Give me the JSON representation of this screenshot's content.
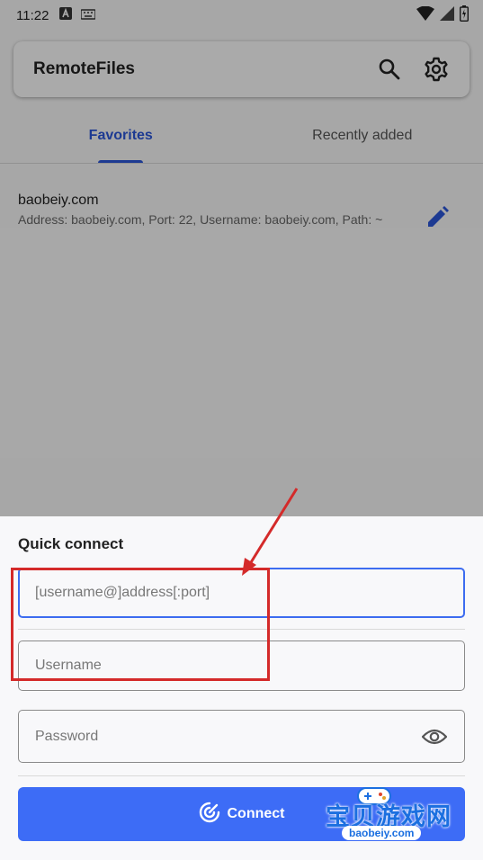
{
  "status_bar": {
    "time": "11:22"
  },
  "header": {
    "title": "RemoteFiles",
    "search_icon": "search-icon",
    "settings_icon": "gear-icon"
  },
  "tabs": [
    {
      "label": "Favorites",
      "active": true
    },
    {
      "label": "Recently added",
      "active": false
    }
  ],
  "favorites": [
    {
      "name": "baobeiy.com",
      "details": "Address: baobeiy.com, Port: 22, Username: baobeiy.com, Path: ~"
    }
  ],
  "quick_connect": {
    "title": "Quick connect",
    "address_placeholder": "[username@]address[:port]",
    "username_placeholder": "Username",
    "password_placeholder": "Password",
    "connect_label": "Connect"
  },
  "watermark": {
    "cn": "宝贝游戏网",
    "en": "baobeiy.com"
  },
  "colors": {
    "accent": "#3d6cf6",
    "annotation": "#d42a2a",
    "tab_active": "#2b56d8"
  }
}
